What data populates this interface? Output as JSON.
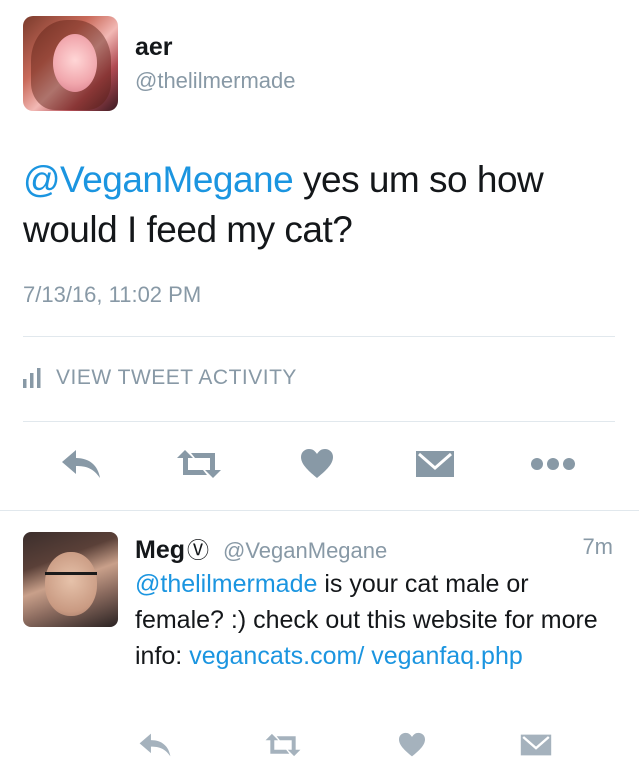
{
  "main_tweet": {
    "author_name": "aer",
    "author_handle": "@thelilmermade",
    "mention": "@VeganMegane",
    "text": " yes um so how would I feed my cat?",
    "timestamp": "7/13/16, 11:02 PM",
    "activity_label": "VIEW TWEET ACTIVITY",
    "actions": [
      "reply-icon",
      "retweet-icon",
      "like-icon",
      "direct-message-icon",
      "more-icon"
    ]
  },
  "reply_tweet": {
    "author_name": "Meg",
    "verified_mark": "Ⓥ",
    "author_handle": "@VeganMegane",
    "time": "7m",
    "mention": "@thelilmermade",
    "text_1": " is your cat male or female? :) check out this website for more info: ",
    "link": "vegancats.com/ veganfaq.php",
    "actions": [
      "reply-icon",
      "retweet-icon",
      "like-icon",
      "direct-message-icon"
    ]
  },
  "colors": {
    "link": "#1b95e0",
    "text": "#14171a",
    "muted": "#8899a6",
    "icon": "#8899a6",
    "divider": "#e1e8ed"
  }
}
